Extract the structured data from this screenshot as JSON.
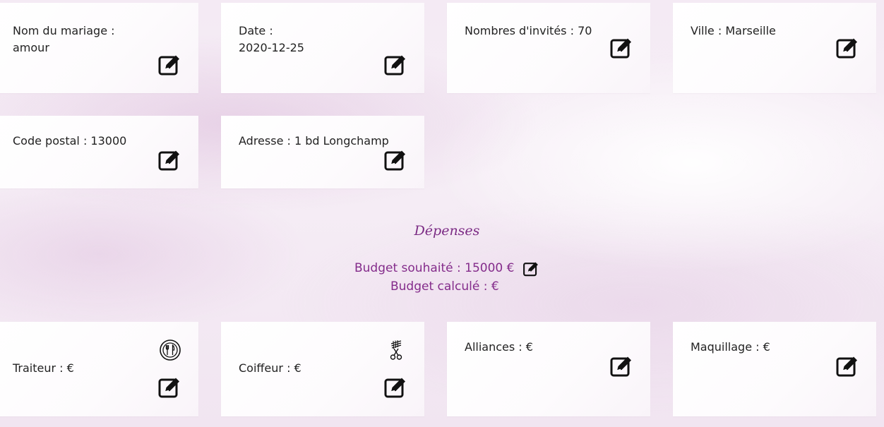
{
  "colors": {
    "accent": "#842c8b",
    "text": "#222222",
    "card_bg": "#ffffff",
    "page_bg": "#f4eaf4"
  },
  "info_cards": [
    {
      "label": "Nom du mariage :",
      "value": "amour",
      "icon": "edit-icon"
    },
    {
      "label": "Date :",
      "value": "2020-12-25",
      "icon": "edit-icon"
    },
    {
      "label": "Nombres d'invités : 70",
      "icon": "edit-icon"
    },
    {
      "label": "Ville : Marseille",
      "icon": "edit-icon"
    },
    {
      "label": "Code postal : 13000",
      "icon": "edit-icon"
    },
    {
      "label": "Adresse : 1 bd Longchamp",
      "icon": "edit-icon"
    }
  ],
  "expenses": {
    "title": "Dépenses",
    "budget_wished": "Budget souhaité : 15000 €",
    "budget_calculated": "Budget calculé : €",
    "items": [
      {
        "label": "Traiteur : €",
        "category_icon": "plate-cutlery-icon",
        "icon": "edit-icon"
      },
      {
        "label": "Coiffeur : €",
        "category_icon": "scissors-comb-icon",
        "icon": "edit-icon"
      },
      {
        "label": "Alliances : €",
        "icon": "edit-icon"
      },
      {
        "label": "Maquillage : €",
        "icon": "edit-icon"
      }
    ]
  }
}
